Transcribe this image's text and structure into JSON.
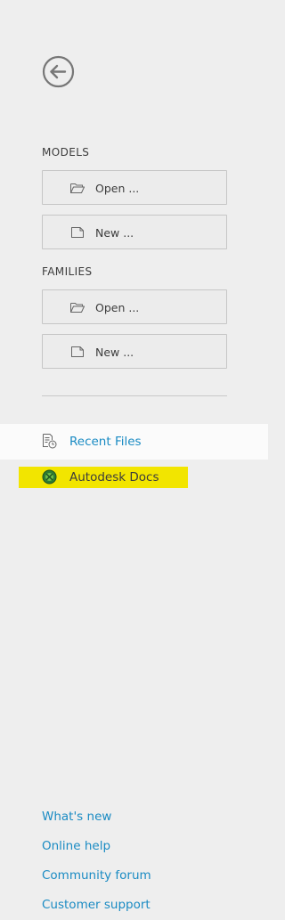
{
  "nav": {
    "back_icon": "back-arrow-circle-icon"
  },
  "models": {
    "label": "MODELS",
    "open_label": "Open ...",
    "new_label": "New ..."
  },
  "families": {
    "label": "FAMILIES",
    "open_label": "Open ...",
    "new_label": "New ..."
  },
  "sidebar": {
    "items": [
      {
        "label": "Recent Files",
        "icon": "recent-files-icon",
        "active": true
      },
      {
        "label": "Autodesk Docs",
        "icon": "autodesk-docs-icon",
        "highlighted": true
      }
    ]
  },
  "footer": {
    "links": [
      {
        "label": "What's new"
      },
      {
        "label": "Online help"
      },
      {
        "label": "Community forum"
      },
      {
        "label": "Customer support"
      }
    ]
  },
  "colors": {
    "background": "#eeeeee",
    "link": "#1a8bc3",
    "highlight": "#f2e500",
    "active_row": "#fbfbfb"
  }
}
